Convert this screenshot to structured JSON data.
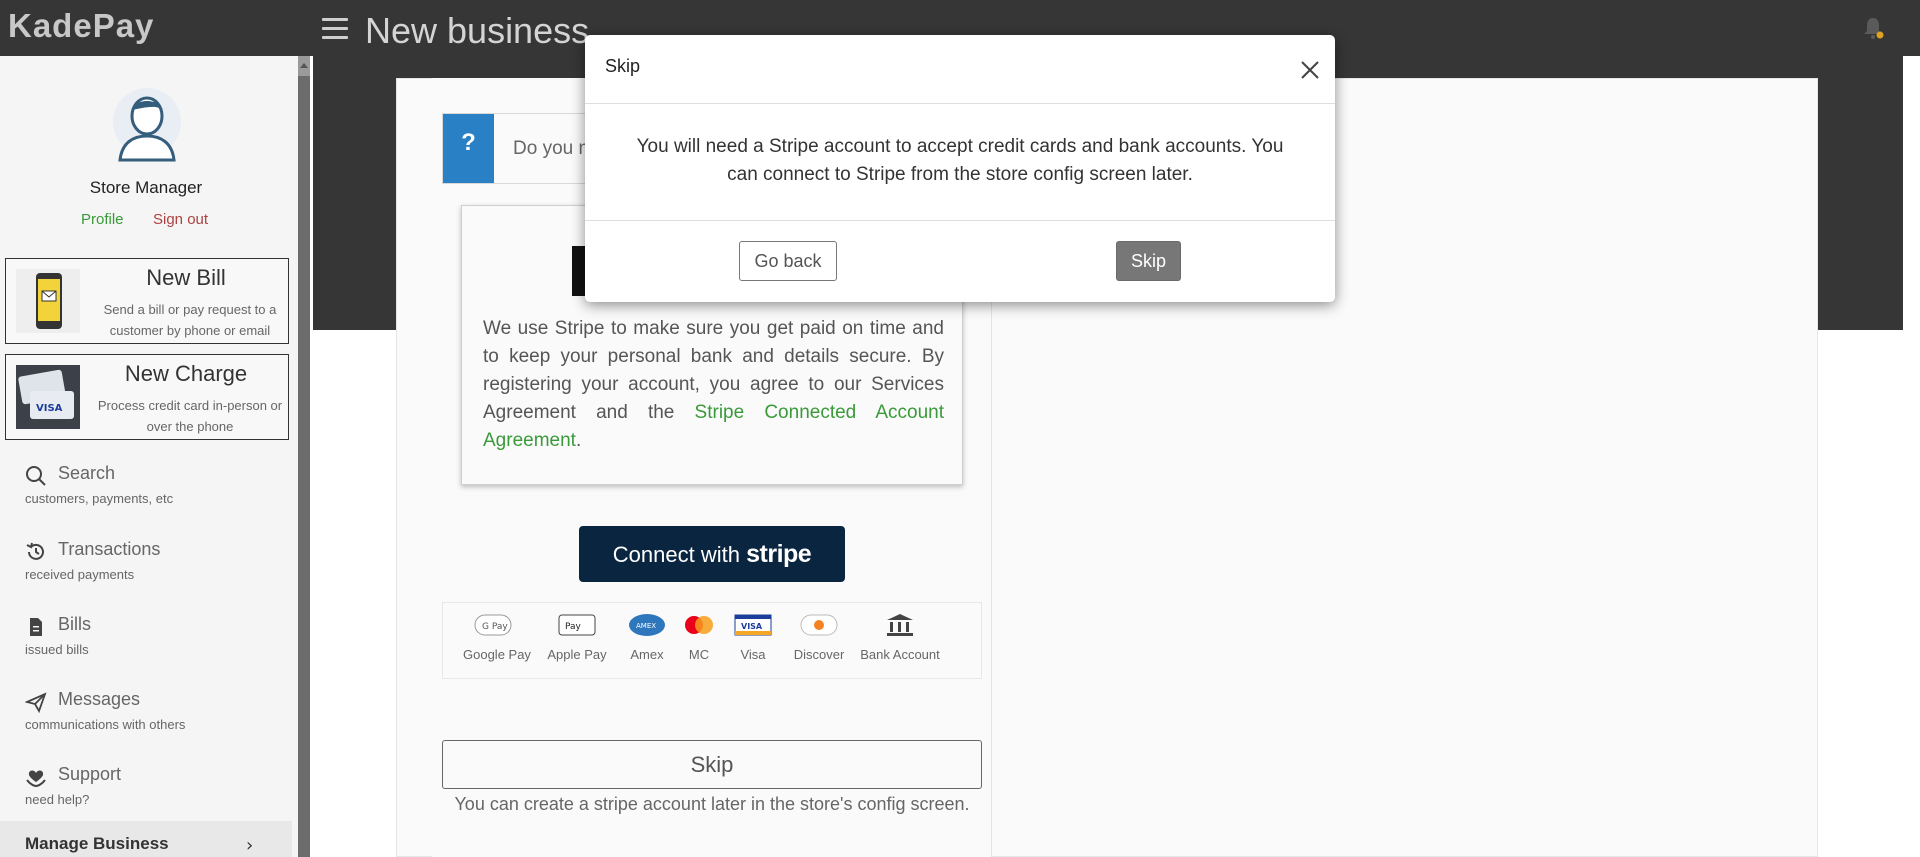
{
  "app": {
    "logo": "KadePay",
    "page_title": "New business"
  },
  "sidebar": {
    "user_name": "Store Manager",
    "profile_label": "Profile",
    "signout_label": "Sign out",
    "new_bill": {
      "title": "New Bill",
      "desc": "Send a bill or pay request to a customer by phone or email"
    },
    "new_charge": {
      "title": "New Charge",
      "desc": "Process credit card in-person or over the phone"
    },
    "items": [
      {
        "label": "Search",
        "sub": "customers, payments, etc",
        "icon": "search-icon"
      },
      {
        "label": "Transactions",
        "sub": "received payments",
        "icon": "history-icon"
      },
      {
        "label": "Bills",
        "sub": "issued bills",
        "icon": "document-icon"
      },
      {
        "label": "Messages",
        "sub": "communications with others",
        "icon": "paper-plane-icon"
      },
      {
        "label": "Support",
        "sub": "need help?",
        "icon": "support-icon"
      }
    ],
    "manage_business": "Manage Business"
  },
  "main": {
    "question_text": "Do you n",
    "stripe_text_1": "We use Stripe to make sure you get paid on time and to keep your personal bank and details secure. By registering your account, you agree to our Services Agreement and the ",
    "stripe_link": "Stripe Connected Account Agreement",
    "stripe_text_2": ".",
    "connect_prefix": "Connect with",
    "connect_brand": "stripe",
    "payment_methods": [
      "Google Pay",
      "Apple Pay",
      "Amex",
      "MC",
      "Visa",
      "Discover",
      "Bank Account"
    ],
    "skip_label": "Skip",
    "skip_note": "You can create a stripe account later in the store's config screen."
  },
  "modal": {
    "title": "Skip",
    "message": "You will need a Stripe account to accept credit cards and bank accounts. You can connect to Stripe from the store config screen later.",
    "go_back_label": "Go back",
    "skip_label": "Skip"
  },
  "colors": {
    "topbar": "#363636",
    "accent_green": "#3a9a3a",
    "signout_red": "#b04040",
    "stripe_navy": "#0a2540",
    "info_blue": "#2a80c4"
  }
}
